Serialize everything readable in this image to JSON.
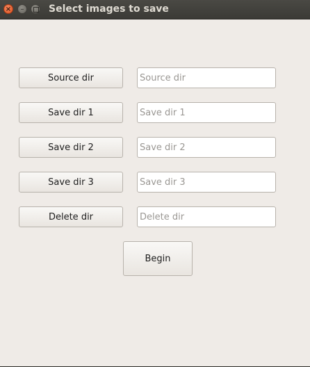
{
  "window": {
    "title": "Select images to save",
    "close_glyph": "×",
    "minimize_glyph": "–"
  },
  "rows": [
    {
      "button_label": "Source dir",
      "placeholder": "Source dir",
      "value": ""
    },
    {
      "button_label": "Save dir 1",
      "placeholder": "Save dir 1",
      "value": ""
    },
    {
      "button_label": "Save dir 2",
      "placeholder": "Save dir 2",
      "value": ""
    },
    {
      "button_label": "Save dir 3",
      "placeholder": "Save dir 3",
      "value": ""
    },
    {
      "button_label": "Delete dir",
      "placeholder": "Delete dir",
      "value": ""
    }
  ],
  "begin_label": "Begin",
  "colors": {
    "window_bg": "#efebe7",
    "titlebar_bg": "#3b3a36",
    "close_button": "#e0521f"
  }
}
